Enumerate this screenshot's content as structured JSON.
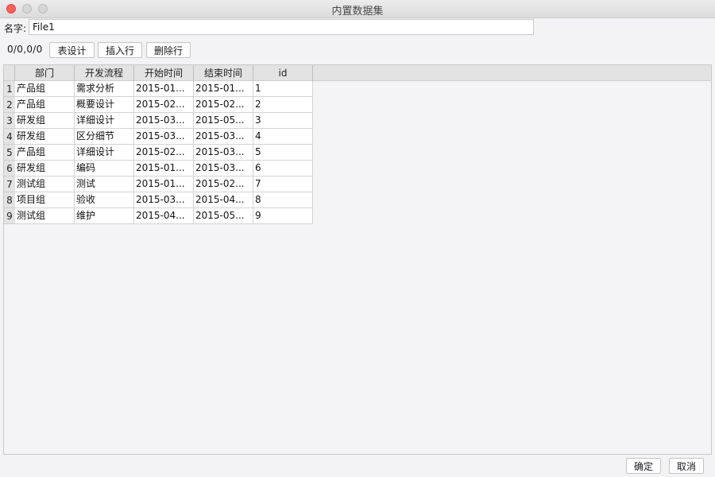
{
  "window": {
    "title": "内置数据集"
  },
  "name": {
    "label": "名字:",
    "value": "File1"
  },
  "toolbar": {
    "row_info": "0/0,0/0",
    "table_design": "表设计",
    "insert_row": "插入行",
    "delete_row": "删除行"
  },
  "table": {
    "columns": [
      "部门",
      "开发流程",
      "开始时间",
      "结束时间",
      "id"
    ],
    "rows": [
      {
        "num": "1",
        "cells": [
          "产品组",
          "需求分析",
          "2015-01...",
          "2015-01...",
          "1"
        ]
      },
      {
        "num": "2",
        "cells": [
          "产品组",
          "概要设计",
          "2015-02...",
          "2015-02...",
          "2"
        ]
      },
      {
        "num": "3",
        "cells": [
          "研发组",
          "详细设计",
          "2015-03...",
          "2015-05...",
          "3"
        ]
      },
      {
        "num": "4",
        "cells": [
          "研发组",
          "区分细节",
          "2015-03...",
          "2015-03...",
          "4"
        ]
      },
      {
        "num": "5",
        "cells": [
          "产品组",
          "详细设计",
          "2015-02...",
          "2015-03...",
          "5"
        ]
      },
      {
        "num": "6",
        "cells": [
          "研发组",
          "编码",
          "2015-01...",
          "2015-03...",
          "6"
        ]
      },
      {
        "num": "7",
        "cells": [
          "测试组",
          "测试",
          "2015-01...",
          "2015-02...",
          "7"
        ]
      },
      {
        "num": "8",
        "cells": [
          "项目组",
          "验收",
          "2015-03...",
          "2015-04...",
          "8"
        ]
      },
      {
        "num": "9",
        "cells": [
          "测试组",
          "维护",
          "2015-04...",
          "2015-05...",
          "9"
        ]
      }
    ]
  },
  "footer": {
    "ok": "确定",
    "cancel": "取消"
  }
}
